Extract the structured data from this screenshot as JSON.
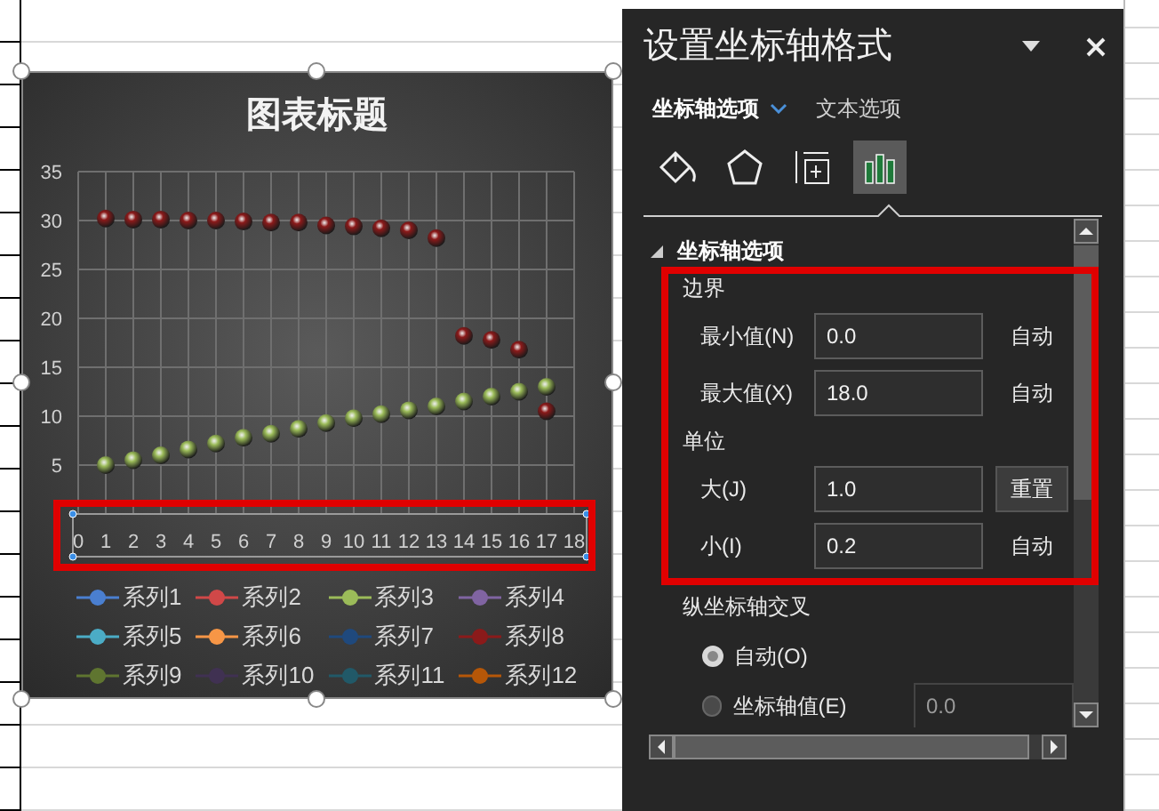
{
  "chart": {
    "title": "图表标题",
    "axis_selected": true,
    "chart_data": {
      "type": "scatter",
      "grid": true,
      "xlim": [
        0,
        18
      ],
      "ylim": [
        0,
        35
      ],
      "xticks": [
        0,
        1,
        2,
        3,
        4,
        5,
        6,
        7,
        8,
        9,
        10,
        11,
        12,
        13,
        14,
        15,
        16,
        17,
        18
      ],
      "yticks": [
        5,
        10,
        15,
        20,
        25,
        30,
        35
      ],
      "series": [
        {
          "name": "系列1",
          "color": "#4a7fd0"
        },
        {
          "name": "系列2",
          "color": "#d04848"
        },
        {
          "name": "系列3",
          "color": "#9bbb59",
          "x": [
            1,
            2,
            3,
            4,
            5,
            6,
            7,
            8,
            9,
            10,
            11,
            12,
            13,
            14,
            15,
            16,
            17
          ],
          "values": [
            5.0,
            5.5,
            6.0,
            6.6,
            7.2,
            7.8,
            8.2,
            8.7,
            9.3,
            9.8,
            10.2,
            10.6,
            11.0,
            11.5,
            12.0,
            12.5,
            13.0
          ]
        },
        {
          "name": "系列4",
          "color": "#8064a2"
        },
        {
          "name": "系列5",
          "color": "#4bacc6"
        },
        {
          "name": "系列6",
          "color": "#f79646"
        },
        {
          "name": "系列7",
          "color": "#1f497d"
        },
        {
          "name": "系列8",
          "color": "#8b1a1a",
          "x": [
            1,
            2,
            3,
            4,
            5,
            6,
            7,
            8,
            9,
            10,
            11,
            12,
            13,
            14,
            15,
            16,
            17
          ],
          "values": [
            30.2,
            30.1,
            30.1,
            30.0,
            30.0,
            29.9,
            29.8,
            29.8,
            29.5,
            29.4,
            29.2,
            29.0,
            28.2,
            18.2,
            17.8,
            16.8,
            10.5
          ]
        },
        {
          "name": "系列9",
          "color": "#5f7530"
        },
        {
          "name": "系列10",
          "color": "#403152"
        },
        {
          "name": "系列11",
          "color": "#215968"
        },
        {
          "name": "系列12",
          "color": "#b65708"
        }
      ]
    }
  },
  "panel": {
    "title": "设置坐标轴格式",
    "tabs": [
      {
        "label": "坐标轴选项",
        "selected": true
      },
      {
        "label": "文本选项",
        "selected": false
      }
    ],
    "icon_tabs": [
      {
        "kind": "fill",
        "selected": false
      },
      {
        "kind": "effects",
        "selected": false
      },
      {
        "kind": "size",
        "selected": false
      },
      {
        "kind": "options",
        "selected": true
      }
    ],
    "section": {
      "title": "坐标轴选项",
      "expanded": true
    },
    "groups": [
      {
        "title": "边界",
        "rows": [
          {
            "label": "最小值(N)",
            "value": "0.0",
            "action": {
              "kind": "auto",
              "label": "自动"
            }
          },
          {
            "label": "最大值(X)",
            "value": "18.0",
            "action": {
              "kind": "auto",
              "label": "自动"
            }
          }
        ]
      },
      {
        "title": "单位",
        "rows": [
          {
            "label": "大(J)",
            "value": "1.0",
            "action": {
              "kind": "reset",
              "label": "重置"
            }
          },
          {
            "label": "小(I)",
            "value": "0.2",
            "action": {
              "kind": "auto",
              "label": "自动"
            }
          }
        ]
      }
    ],
    "crosses": {
      "title": "纵坐标轴交叉",
      "options": [
        {
          "label": "自动(O)",
          "selected": true
        },
        {
          "label": "坐标轴值(E)",
          "selected": false,
          "value": "0.0"
        }
      ]
    }
  }
}
